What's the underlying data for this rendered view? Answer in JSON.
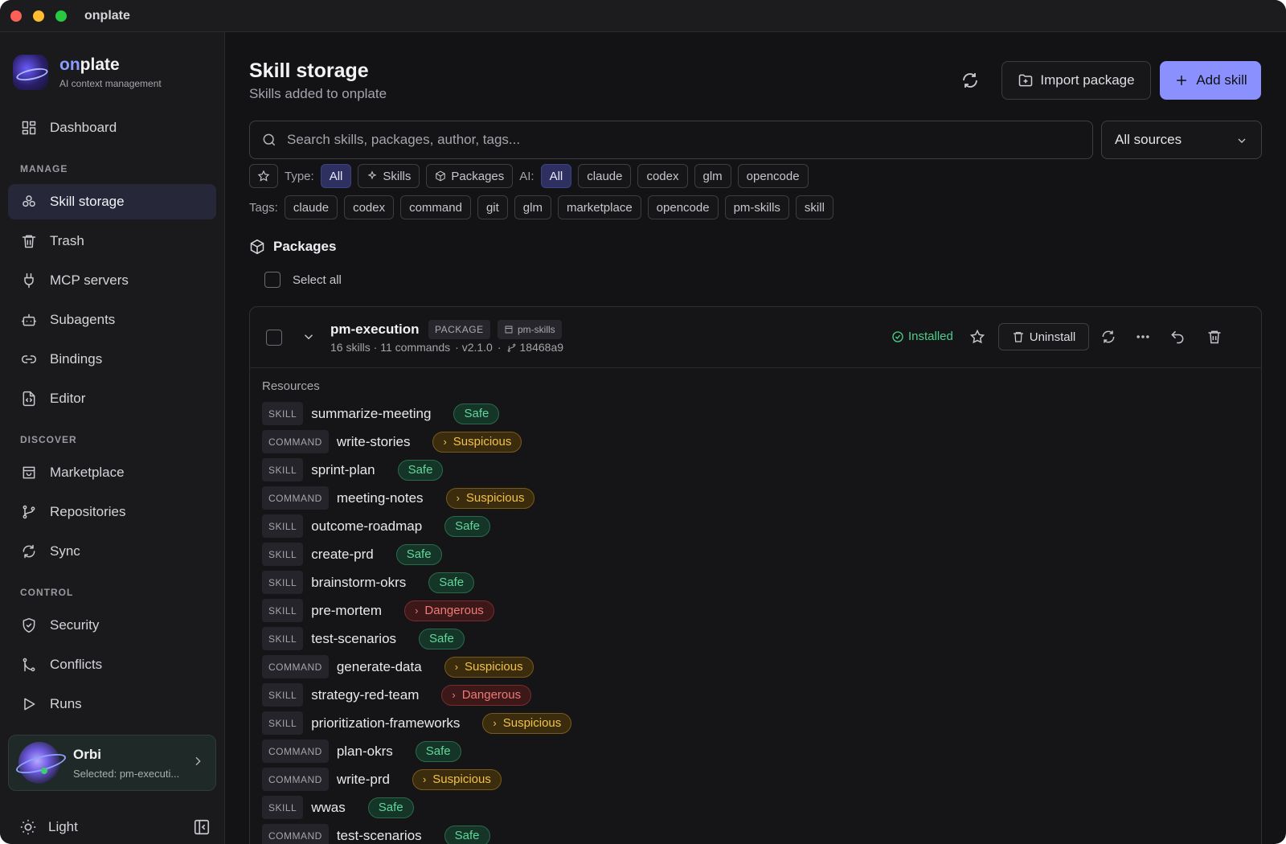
{
  "window": {
    "title": "onplate"
  },
  "brand": {
    "name_prefix": "on",
    "name_suffix": "plate",
    "subtitle": "AI context management"
  },
  "sidebar": {
    "items": [
      {
        "label": "Dashboard",
        "icon": "dashboard-icon"
      },
      {
        "label": "Skill storage",
        "icon": "skills-icon",
        "active": true
      },
      {
        "label": "Trash",
        "icon": "trash-icon"
      },
      {
        "label": "MCP servers",
        "icon": "plug-icon"
      },
      {
        "label": "Subagents",
        "icon": "bot-icon"
      },
      {
        "label": "Bindings",
        "icon": "link-icon"
      },
      {
        "label": "Editor",
        "icon": "file-code-icon"
      },
      {
        "label": "Marketplace",
        "icon": "store-icon"
      },
      {
        "label": "Repositories",
        "icon": "git-branch-icon"
      },
      {
        "label": "Sync",
        "icon": "sync-icon"
      },
      {
        "label": "Security",
        "icon": "shield-icon"
      },
      {
        "label": "Conflicts",
        "icon": "git-merge-icon"
      },
      {
        "label": "Runs",
        "icon": "play-icon"
      }
    ],
    "sections": {
      "manage": "MANAGE",
      "discover": "DISCOVER",
      "control": "CONTROL"
    },
    "orbi": {
      "name": "Orbi",
      "selected": "Selected: pm-executi..."
    },
    "theme_label": "Light"
  },
  "header": {
    "title": "Skill storage",
    "subtitle": "Skills added to onplate",
    "import_label": "Import package",
    "add_label": "Add skill"
  },
  "search": {
    "placeholder": "Search skills, packages, author, tags..."
  },
  "source_select": {
    "value": "All sources"
  },
  "filters": {
    "type_label": "Type:",
    "types": [
      "All",
      "Skills",
      "Packages"
    ],
    "ai_label": "AI:",
    "ais": [
      "All",
      "claude",
      "codex",
      "glm",
      "opencode"
    ],
    "tags_label": "Tags:",
    "tags": [
      "claude",
      "codex",
      "command",
      "git",
      "glm",
      "marketplace",
      "opencode",
      "pm-skills",
      "skill"
    ]
  },
  "packages_section": {
    "title": "Packages",
    "select_all": "Select all"
  },
  "package": {
    "name": "pm-execution",
    "kind_tag": "PACKAGE",
    "source_tag": "pm-skills",
    "counts": "16 skills · 11 commands",
    "version": "· v2.1.0",
    "sep": "·",
    "commit": "18468a9",
    "status": "Installed",
    "uninstall_label": "Uninstall",
    "resources_label": "Resources",
    "resources": [
      {
        "kind": "SKILL",
        "name": "summarize-meeting",
        "status": "Safe"
      },
      {
        "kind": "COMMAND",
        "name": "write-stories",
        "status": "Suspicious"
      },
      {
        "kind": "SKILL",
        "name": "sprint-plan",
        "status": "Safe"
      },
      {
        "kind": "COMMAND",
        "name": "meeting-notes",
        "status": "Suspicious"
      },
      {
        "kind": "SKILL",
        "name": "outcome-roadmap",
        "status": "Safe"
      },
      {
        "kind": "SKILL",
        "name": "create-prd",
        "status": "Safe"
      },
      {
        "kind": "SKILL",
        "name": "brainstorm-okrs",
        "status": "Safe"
      },
      {
        "kind": "SKILL",
        "name": "pre-mortem",
        "status": "Dangerous"
      },
      {
        "kind": "SKILL",
        "name": "test-scenarios",
        "status": "Safe"
      },
      {
        "kind": "COMMAND",
        "name": "generate-data",
        "status": "Suspicious"
      },
      {
        "kind": "SKILL",
        "name": "strategy-red-team",
        "status": "Dangerous"
      },
      {
        "kind": "SKILL",
        "name": "prioritization-frameworks",
        "status": "Suspicious"
      },
      {
        "kind": "COMMAND",
        "name": "plan-okrs",
        "status": "Safe"
      },
      {
        "kind": "COMMAND",
        "name": "write-prd",
        "status": "Suspicious"
      },
      {
        "kind": "SKILL",
        "name": "wwas",
        "status": "Safe"
      },
      {
        "kind": "COMMAND",
        "name": "test-scenarios",
        "status": "Safe"
      }
    ]
  },
  "colors": {
    "accent": "#8a91ff",
    "safe": "#62d79a",
    "suspicious": "#f2c14d",
    "dangerous": "#f07a77",
    "installed": "#4cd08a"
  }
}
